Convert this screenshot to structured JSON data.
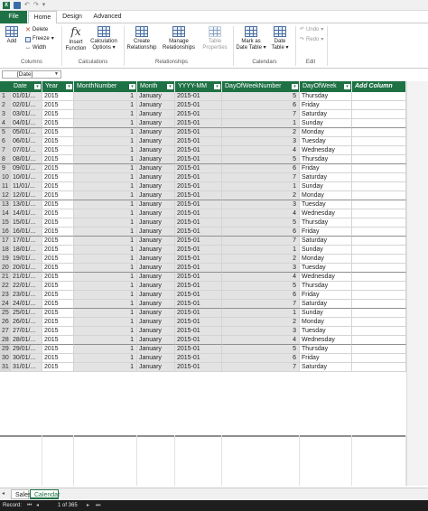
{
  "tabs": {
    "file": "File",
    "home": "Home",
    "design": "Design",
    "advanced": "Advanced"
  },
  "ribbon": {
    "columns": {
      "add": "Add",
      "delete": "Delete",
      "freeze": "Freeze",
      "width": "Width",
      "group": "Columns"
    },
    "calculations": {
      "insert_function_1": "Insert",
      "insert_function_2": "Function",
      "calc_options_1": "Calculation",
      "calc_options_2": "Options",
      "group": "Calculations"
    },
    "relationships": {
      "create_1": "Create",
      "create_2": "Relationship",
      "manage_1": "Manage",
      "manage_2": "Relationships",
      "table_props_1": "Table",
      "table_props_2": "Properties",
      "group": "Relationships"
    },
    "calendars": {
      "mark_1": "Mark as",
      "mark_2": "Date Table",
      "date_1": "Date",
      "date_2": "Table",
      "group": "Calendars"
    },
    "edit": {
      "undo": "Undo",
      "redo": "Redo",
      "group": "Edit"
    }
  },
  "namebox": {
    "value": "[Date]"
  },
  "columns": [
    "Date",
    "Year",
    "MonthNumber",
    "Month",
    "YYYY-MM",
    "DayOfWeekNumber",
    "DayOfWeek"
  ],
  "add_column": "Add Column",
  "rows": [
    [
      "1",
      "01/01/...",
      "2015",
      "1",
      "January",
      "2015-01",
      "5",
      "Thursday"
    ],
    [
      "2",
      "02/01/...",
      "2015",
      "1",
      "January",
      "2015-01",
      "6",
      "Friday"
    ],
    [
      "3",
      "03/01/...",
      "2015",
      "1",
      "January",
      "2015-01",
      "7",
      "Saturday"
    ],
    [
      "4",
      "04/01/...",
      "2015",
      "1",
      "January",
      "2015-01",
      "1",
      "Sunday"
    ],
    [
      "5",
      "05/01/...",
      "2015",
      "1",
      "January",
      "2015-01",
      "2",
      "Monday"
    ],
    [
      "6",
      "06/01/...",
      "2015",
      "1",
      "January",
      "2015-01",
      "3",
      "Tuesday"
    ],
    [
      "7",
      "07/01/...",
      "2015",
      "1",
      "January",
      "2015-01",
      "4",
      "Wednesday"
    ],
    [
      "8",
      "08/01/...",
      "2015",
      "1",
      "January",
      "2015-01",
      "5",
      "Thursday"
    ],
    [
      "9",
      "09/01/...",
      "2015",
      "1",
      "January",
      "2015-01",
      "6",
      "Friday"
    ],
    [
      "10",
      "10/01/...",
      "2015",
      "1",
      "January",
      "2015-01",
      "7",
      "Saturday"
    ],
    [
      "11",
      "11/01/...",
      "2015",
      "1",
      "January",
      "2015-01",
      "1",
      "Sunday"
    ],
    [
      "12",
      "12/01/...",
      "2015",
      "1",
      "January",
      "2015-01",
      "2",
      "Monday"
    ],
    [
      "13",
      "13/01/...",
      "2015",
      "1",
      "January",
      "2015-01",
      "3",
      "Tuesday"
    ],
    [
      "14",
      "14/01/...",
      "2015",
      "1",
      "January",
      "2015-01",
      "4",
      "Wednesday"
    ],
    [
      "15",
      "15/01/...",
      "2015",
      "1",
      "January",
      "2015-01",
      "5",
      "Thursday"
    ],
    [
      "16",
      "16/01/...",
      "2015",
      "1",
      "January",
      "2015-01",
      "6",
      "Friday"
    ],
    [
      "17",
      "17/01/...",
      "2015",
      "1",
      "January",
      "2015-01",
      "7",
      "Saturday"
    ],
    [
      "18",
      "18/01/...",
      "2015",
      "1",
      "January",
      "2015-01",
      "1",
      "Sunday"
    ],
    [
      "19",
      "19/01/...",
      "2015",
      "1",
      "January",
      "2015-01",
      "2",
      "Monday"
    ],
    [
      "20",
      "20/01/...",
      "2015",
      "1",
      "January",
      "2015-01",
      "3",
      "Tuesday"
    ],
    [
      "21",
      "21/01/...",
      "2015",
      "1",
      "January",
      "2015-01",
      "4",
      "Wednesday"
    ],
    [
      "22",
      "22/01/...",
      "2015",
      "1",
      "January",
      "2015-01",
      "5",
      "Thursday"
    ],
    [
      "23",
      "23/01/...",
      "2015",
      "1",
      "January",
      "2015-01",
      "6",
      "Friday"
    ],
    [
      "24",
      "24/01/...",
      "2015",
      "1",
      "January",
      "2015-01",
      "7",
      "Saturday"
    ],
    [
      "25",
      "25/01/...",
      "2015",
      "1",
      "January",
      "2015-01",
      "1",
      "Sunday"
    ],
    [
      "26",
      "26/01/...",
      "2015",
      "1",
      "January",
      "2015-01",
      "2",
      "Monday"
    ],
    [
      "27",
      "27/01/...",
      "2015",
      "1",
      "January",
      "2015-01",
      "3",
      "Tuesday"
    ],
    [
      "28",
      "28/01/...",
      "2015",
      "1",
      "January",
      "2015-01",
      "4",
      "Wednesday"
    ],
    [
      "29",
      "29/01/...",
      "2015",
      "1",
      "January",
      "2015-01",
      "5",
      "Thursday"
    ],
    [
      "30",
      "30/01/...",
      "2015",
      "1",
      "January",
      "2015-01",
      "6",
      "Friday"
    ],
    [
      "31",
      "31/01/...",
      "2015",
      "1",
      "January",
      "2015-01",
      "7",
      "Saturday"
    ]
  ],
  "sheets": {
    "sales": "Sales",
    "calendar": "Calendar"
  },
  "status": {
    "record_label": "Record:",
    "record_count": "1 of 365"
  },
  "colors": {
    "accent": "#1e7145"
  },
  "icons": [
    "excel-icon",
    "save-icon",
    "undo-icon",
    "redo-icon",
    "add-column-icon",
    "delete-icon",
    "freeze-icon",
    "width-icon",
    "function-icon",
    "calculation-options-icon",
    "create-relationship-icon",
    "manage-relationships-icon",
    "table-properties-icon",
    "mark-date-table-icon",
    "date-table-icon"
  ]
}
